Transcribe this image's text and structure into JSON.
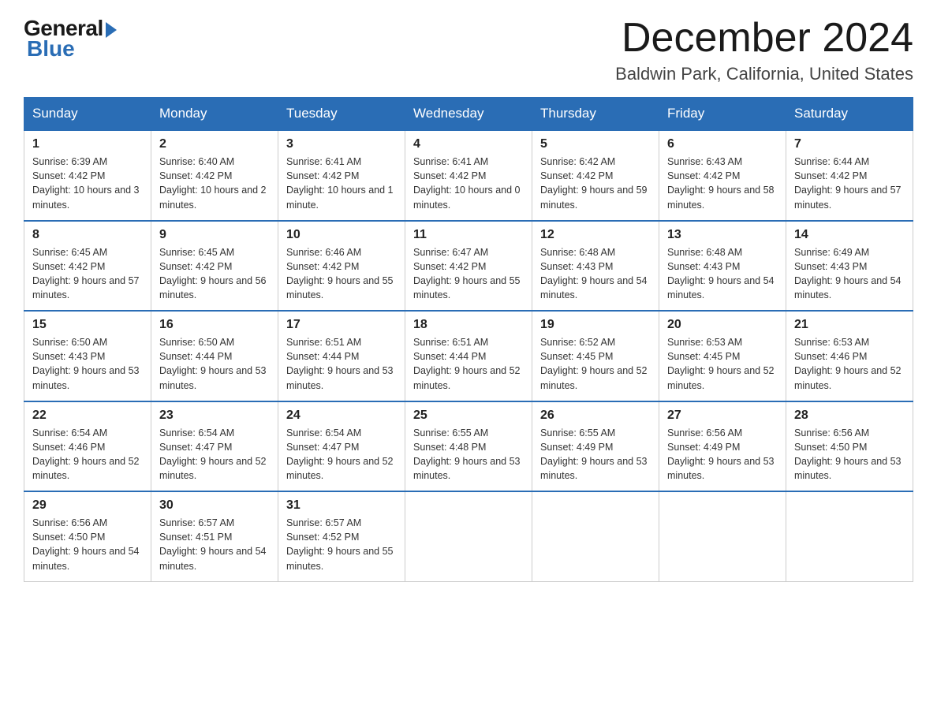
{
  "header": {
    "logo_general": "General",
    "logo_blue": "Blue",
    "month_title": "December 2024",
    "location": "Baldwin Park, California, United States"
  },
  "weekdays": [
    "Sunday",
    "Monday",
    "Tuesday",
    "Wednesday",
    "Thursday",
    "Friday",
    "Saturday"
  ],
  "weeks": [
    [
      {
        "day": "1",
        "sunrise": "6:39 AM",
        "sunset": "4:42 PM",
        "daylight": "10 hours and 3 minutes."
      },
      {
        "day": "2",
        "sunrise": "6:40 AM",
        "sunset": "4:42 PM",
        "daylight": "10 hours and 2 minutes."
      },
      {
        "day": "3",
        "sunrise": "6:41 AM",
        "sunset": "4:42 PM",
        "daylight": "10 hours and 1 minute."
      },
      {
        "day": "4",
        "sunrise": "6:41 AM",
        "sunset": "4:42 PM",
        "daylight": "10 hours and 0 minutes."
      },
      {
        "day": "5",
        "sunrise": "6:42 AM",
        "sunset": "4:42 PM",
        "daylight": "9 hours and 59 minutes."
      },
      {
        "day": "6",
        "sunrise": "6:43 AM",
        "sunset": "4:42 PM",
        "daylight": "9 hours and 58 minutes."
      },
      {
        "day": "7",
        "sunrise": "6:44 AM",
        "sunset": "4:42 PM",
        "daylight": "9 hours and 57 minutes."
      }
    ],
    [
      {
        "day": "8",
        "sunrise": "6:45 AM",
        "sunset": "4:42 PM",
        "daylight": "9 hours and 57 minutes."
      },
      {
        "day": "9",
        "sunrise": "6:45 AM",
        "sunset": "4:42 PM",
        "daylight": "9 hours and 56 minutes."
      },
      {
        "day": "10",
        "sunrise": "6:46 AM",
        "sunset": "4:42 PM",
        "daylight": "9 hours and 55 minutes."
      },
      {
        "day": "11",
        "sunrise": "6:47 AM",
        "sunset": "4:42 PM",
        "daylight": "9 hours and 55 minutes."
      },
      {
        "day": "12",
        "sunrise": "6:48 AM",
        "sunset": "4:43 PM",
        "daylight": "9 hours and 54 minutes."
      },
      {
        "day": "13",
        "sunrise": "6:48 AM",
        "sunset": "4:43 PM",
        "daylight": "9 hours and 54 minutes."
      },
      {
        "day": "14",
        "sunrise": "6:49 AM",
        "sunset": "4:43 PM",
        "daylight": "9 hours and 54 minutes."
      }
    ],
    [
      {
        "day": "15",
        "sunrise": "6:50 AM",
        "sunset": "4:43 PM",
        "daylight": "9 hours and 53 minutes."
      },
      {
        "day": "16",
        "sunrise": "6:50 AM",
        "sunset": "4:44 PM",
        "daylight": "9 hours and 53 minutes."
      },
      {
        "day": "17",
        "sunrise": "6:51 AM",
        "sunset": "4:44 PM",
        "daylight": "9 hours and 53 minutes."
      },
      {
        "day": "18",
        "sunrise": "6:51 AM",
        "sunset": "4:44 PM",
        "daylight": "9 hours and 52 minutes."
      },
      {
        "day": "19",
        "sunrise": "6:52 AM",
        "sunset": "4:45 PM",
        "daylight": "9 hours and 52 minutes."
      },
      {
        "day": "20",
        "sunrise": "6:53 AM",
        "sunset": "4:45 PM",
        "daylight": "9 hours and 52 minutes."
      },
      {
        "day": "21",
        "sunrise": "6:53 AM",
        "sunset": "4:46 PM",
        "daylight": "9 hours and 52 minutes."
      }
    ],
    [
      {
        "day": "22",
        "sunrise": "6:54 AM",
        "sunset": "4:46 PM",
        "daylight": "9 hours and 52 minutes."
      },
      {
        "day": "23",
        "sunrise": "6:54 AM",
        "sunset": "4:47 PM",
        "daylight": "9 hours and 52 minutes."
      },
      {
        "day": "24",
        "sunrise": "6:54 AM",
        "sunset": "4:47 PM",
        "daylight": "9 hours and 52 minutes."
      },
      {
        "day": "25",
        "sunrise": "6:55 AM",
        "sunset": "4:48 PM",
        "daylight": "9 hours and 53 minutes."
      },
      {
        "day": "26",
        "sunrise": "6:55 AM",
        "sunset": "4:49 PM",
        "daylight": "9 hours and 53 minutes."
      },
      {
        "day": "27",
        "sunrise": "6:56 AM",
        "sunset": "4:49 PM",
        "daylight": "9 hours and 53 minutes."
      },
      {
        "day": "28",
        "sunrise": "6:56 AM",
        "sunset": "4:50 PM",
        "daylight": "9 hours and 53 minutes."
      }
    ],
    [
      {
        "day": "29",
        "sunrise": "6:56 AM",
        "sunset": "4:50 PM",
        "daylight": "9 hours and 54 minutes."
      },
      {
        "day": "30",
        "sunrise": "6:57 AM",
        "sunset": "4:51 PM",
        "daylight": "9 hours and 54 minutes."
      },
      {
        "day": "31",
        "sunrise": "6:57 AM",
        "sunset": "4:52 PM",
        "daylight": "9 hours and 55 minutes."
      },
      null,
      null,
      null,
      null
    ]
  ],
  "labels": {
    "sunrise": "Sunrise:",
    "sunset": "Sunset:",
    "daylight": "Daylight:"
  }
}
